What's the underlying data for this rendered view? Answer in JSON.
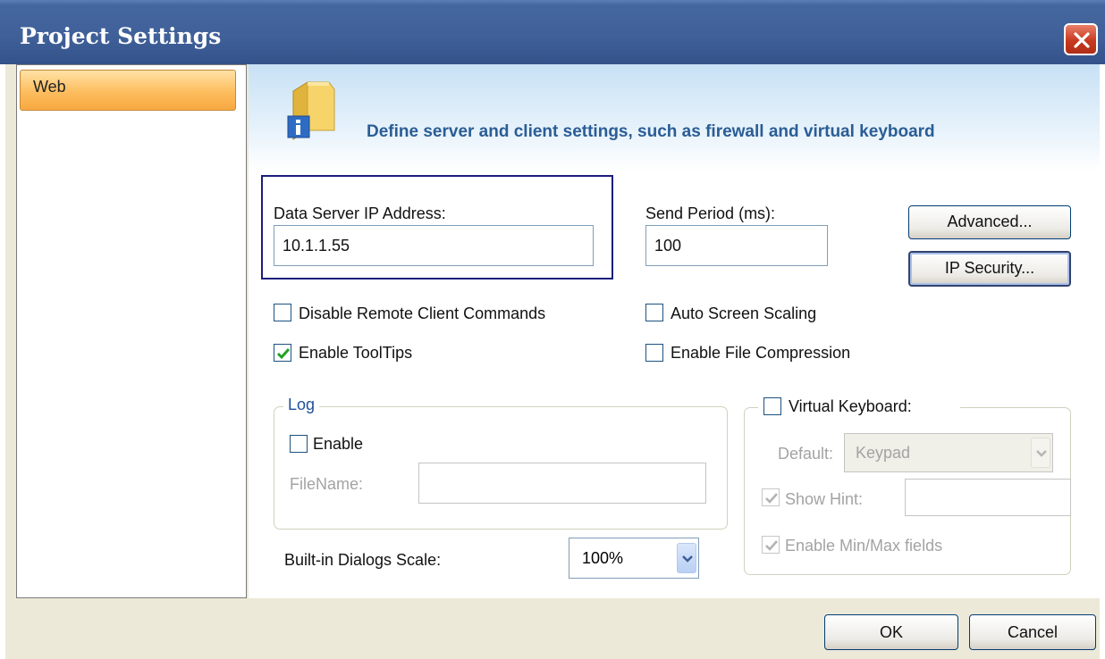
{
  "window": {
    "title": "Project Settings"
  },
  "sidebar": {
    "items": [
      {
        "label": "Web"
      }
    ]
  },
  "header": {
    "text": "Define server and  client settings, such as firewall and virtual keyboard"
  },
  "server": {
    "ip_label": "Data Server IP Address:",
    "ip_value": "10.1.1.55",
    "period_label": "Send Period (ms):",
    "period_value": "100"
  },
  "buttons": {
    "advanced": "Advanced...",
    "ip_security": "IP Security...",
    "ok": "OK",
    "cancel": "Cancel"
  },
  "options": {
    "disable_remote": {
      "label": "Disable Remote Client Commands",
      "checked": false
    },
    "enable_tooltips": {
      "label": "Enable ToolTips",
      "checked": true
    },
    "auto_scaling": {
      "label": "Auto Screen Scaling",
      "checked": false
    },
    "file_compression": {
      "label": "Enable File Compression",
      "checked": false
    }
  },
  "log": {
    "group_label": "Log",
    "enable_label": "Enable",
    "enable_checked": false,
    "filename_label": "FileName:",
    "filename_value": ""
  },
  "dialogs_scale": {
    "label": "Built-in Dialogs Scale:",
    "value": "100%"
  },
  "virtual_keyboard": {
    "label": "Virtual Keyboard:",
    "checked": false,
    "default_label": "Default:",
    "default_value": "Keypad",
    "show_hint_label": "Show Hint:",
    "show_hint_checked": true,
    "show_hint_value": "",
    "minmax_label": "Enable Min/Max fields",
    "minmax_checked": true
  },
  "colors": {
    "titlebar": "#3f5f98",
    "accent": "#2a5d95",
    "selected_item": "#fdbd5e",
    "check": "#21a121"
  }
}
